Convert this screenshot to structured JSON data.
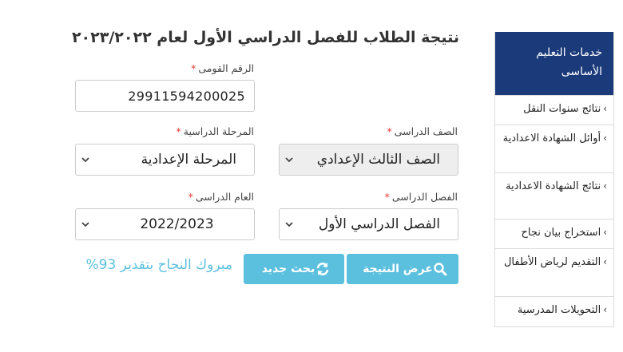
{
  "page": {
    "title": "نتيجة الطلاب للفصل الدراسي الأول لعام ٢٠٢٣/٢٠٢٢"
  },
  "sidebar": {
    "header": "خدمات التعليم الأساسى",
    "items": [
      {
        "label": "نتائج سنوات النقل"
      },
      {
        "label": "أوائل الشهادة الاعدادية"
      },
      {
        "label": "نتائج الشهادة الاعدادية"
      },
      {
        "label": "استخراج بيان نجاح"
      },
      {
        "label": "التقديم لرياض الأطفال"
      },
      {
        "label": "التحويلات المدرسية"
      }
    ]
  },
  "form": {
    "required_mark": "*",
    "national_id": {
      "label": "الرقم القومى",
      "value": "29911594200025"
    },
    "stage": {
      "label": "المرحلة الدراسية",
      "value": "المرحلة الإعدادية"
    },
    "grade": {
      "label": "الصف الدراسى",
      "value": "الصف الثالث الإعدادي"
    },
    "year": {
      "label": "العام الدراسى",
      "value": "2022/2023"
    },
    "term": {
      "label": "الفصل الدراسى",
      "value": "الفصل الدراسي الأول"
    }
  },
  "actions": {
    "show_result": "عرض النتيجة",
    "new_search": "بحث جديد"
  },
  "result": {
    "message": "مبروك النجاح بتقدير 93%"
  },
  "colors": {
    "sidebar_header": "#1b3a7a",
    "button": "#5bc0de",
    "success_text": "#5bc0de",
    "required": "#e53935"
  }
}
